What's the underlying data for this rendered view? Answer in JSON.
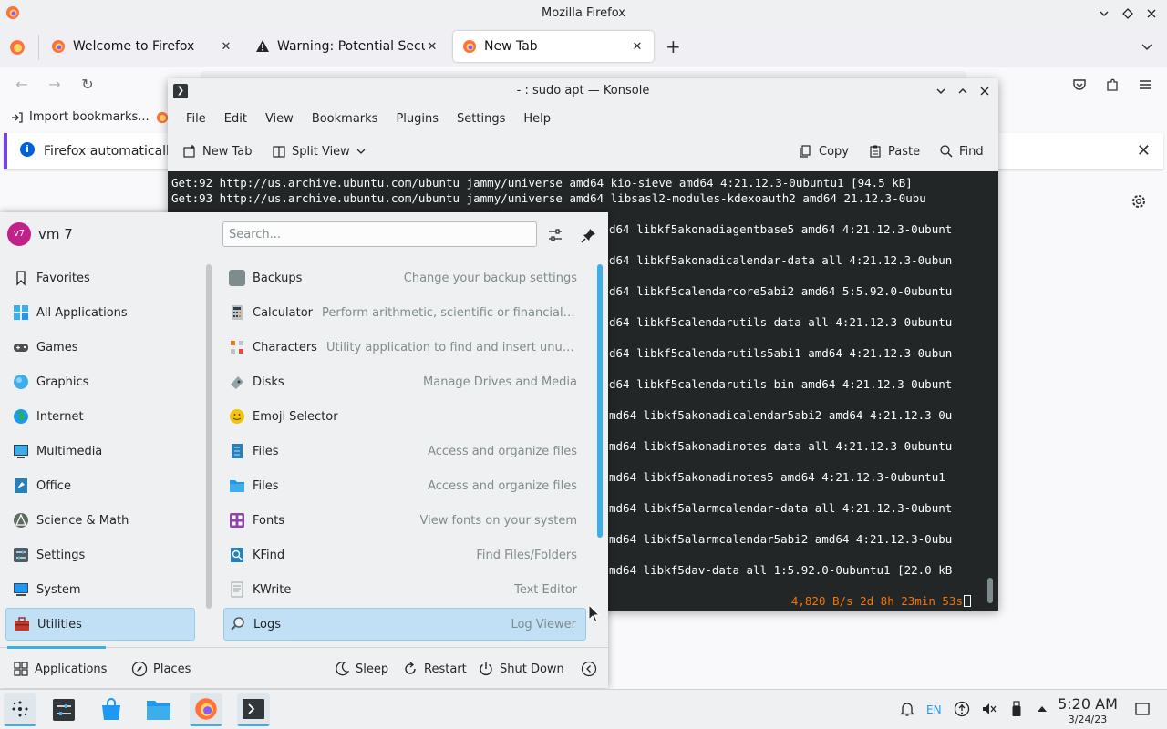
{
  "firefox": {
    "window_title": "Mozilla Firefox",
    "tabs": [
      {
        "label": "Welcome to Firefox",
        "icon": "firefox-icon"
      },
      {
        "label": "Warning: Potential Security",
        "icon": "warning-icon"
      },
      {
        "label": "New Tab",
        "icon": "firefox-icon",
        "active": true
      }
    ],
    "bookmarks": {
      "import_label": "Import bookmarks..."
    },
    "notice": {
      "text": "Firefox automatically s"
    }
  },
  "konsole": {
    "window_title": "- : sudo apt — Konsole",
    "menu": [
      "File",
      "Edit",
      "View",
      "Bookmarks",
      "Plugins",
      "Settings",
      "Help"
    ],
    "toolbar": {
      "new_tab": "New Tab",
      "split_view": "Split View",
      "copy": "Copy",
      "paste": "Paste",
      "find": "Find"
    },
    "terminal_lines": [
      "Get:92 http://us.archive.ubuntu.com/ubuntu jammy/universe amd64 kio-sieve amd64 4:21.12.3-0ubuntu1 [94.5 kB]",
      "Get:93 http://us.archive.ubuntu.com/ubuntu jammy/universe amd64 libsasl2-modules-kdexoauth2 amd64 21.12.3-0ubu",
      "d64 libkf5akonadiagentbase5 amd64 4:21.12.3-0ubunt",
      "d64 libkf5akonadicalendar-data all 4:21.12.3-0ubun",
      "d64 libkf5calendarcore5abi2 amd64 5:5.92.0-0ubuntu",
      "d64 libkf5calendarutils-data all 4:21.12.3-0ubuntu",
      "d64 libkf5calendarutils5abi1 amd64 4:21.12.3-0ubun",
      "d64 libkf5calendarutils-bin amd64 4:21.12.3-0ubunt",
      "md64 libkf5akonadicalendar5abi2 amd64 4:21.12.3-0u",
      "md64 libkf5akonadinotes-data all 4:21.12.3-0ubuntu",
      "md64 libkf5akonadinotes5 amd64 4:21.12.3-0ubuntu1",
      "md64 libkf5alarmcalendar-data all 4:21.12.3-0ubunt",
      "md64 libkf5alarmcalendar5abi2 amd64 4:21.12.3-0ubu",
      "md64 libkf5dav-data all 1:5.92.0-0ubuntu1 [22.0 kB"
    ],
    "status_text": "4,820 B/s 2d 8h 23min 53s"
  },
  "kickoff": {
    "user": {
      "initials": "v7",
      "name": "vm 7"
    },
    "search": {
      "placeholder": "Search..."
    },
    "categories": [
      {
        "label": "Favorites",
        "icon": "bookmark-icon",
        "color": "#ffffff"
      },
      {
        "label": "All Applications",
        "icon": "grid-icon",
        "color": "#3daee9"
      },
      {
        "label": "Games",
        "icon": "gamepad-icon",
        "color": "#4d4d4d"
      },
      {
        "label": "Graphics",
        "icon": "graphics-icon",
        "color": "#3daee9"
      },
      {
        "label": "Internet",
        "icon": "globe-icon",
        "color": "#27ae60"
      },
      {
        "label": "Multimedia",
        "icon": "multimedia-icon",
        "color": "#2c3e50"
      },
      {
        "label": "Office",
        "icon": "office-icon",
        "color": "#2980b9"
      },
      {
        "label": "Science & Math",
        "icon": "science-icon",
        "color": "#5d6d5d"
      },
      {
        "label": "Settings",
        "icon": "settings-icon",
        "color": "#4d5b66"
      },
      {
        "label": "System",
        "icon": "system-icon",
        "color": "#3d4a55"
      },
      {
        "label": "Utilities",
        "icon": "toolbox-icon",
        "color": "#c0392b",
        "selected": true
      }
    ],
    "apps": [
      {
        "name": "Backups",
        "desc": "Change your backup settings",
        "icon": "backup-icon",
        "color": "#7f8c8d"
      },
      {
        "name": "Calculator",
        "desc": "Perform arithmetic, scientific or financial calc...",
        "icon": "calculator-icon",
        "color": "#bdc3c7"
      },
      {
        "name": "Characters",
        "desc": "Utility application to find and insert unusual ...",
        "icon": "characters-icon",
        "color": "#e67e22"
      },
      {
        "name": "Disks",
        "desc": "Manage Drives and Media",
        "icon": "disk-icon",
        "color": "#95a5a6"
      },
      {
        "name": "Emoji Selector",
        "desc": "",
        "icon": "emoji-icon",
        "color": "#f1c40f"
      },
      {
        "name": "Files",
        "desc": "Access and organize files",
        "icon": "files-icon",
        "color": "#2980b9"
      },
      {
        "name": "Files",
        "desc": "Access and organize files",
        "icon": "folder-icon",
        "color": "#3daee9"
      },
      {
        "name": "Fonts",
        "desc": "View fonts on your system",
        "icon": "fonts-icon",
        "color": "#8e44ad"
      },
      {
        "name": "KFind",
        "desc": "Find Files/Folders",
        "icon": "kfind-icon",
        "color": "#2980b9"
      },
      {
        "name": "KWrite",
        "desc": "Text Editor",
        "icon": "kwrite-icon",
        "color": "#d5d8dc"
      },
      {
        "name": "Logs",
        "desc": "Log Viewer",
        "icon": "logs-icon",
        "color": "#95a5a6",
        "selected": true
      }
    ],
    "footer": {
      "applications": "Applications",
      "places": "Places",
      "sleep": "Sleep",
      "restart": "Restart",
      "shutdown": "Shut Down"
    }
  },
  "taskbar": {
    "tray": {
      "lang": "EN"
    },
    "clock": {
      "time": "5:20 AM",
      "date": "3/24/23"
    }
  },
  "colors": {
    "accent": "#3daee9",
    "selection": "#c2e0f5",
    "terminal_bg": "#232627",
    "terminal_status": "#f67400"
  }
}
